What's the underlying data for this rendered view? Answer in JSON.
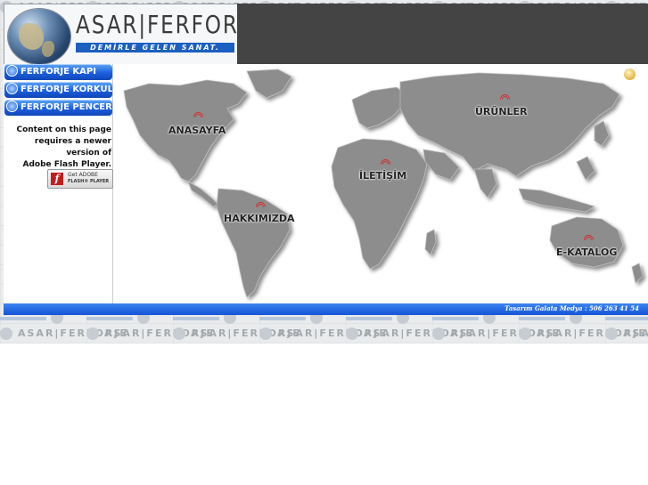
{
  "header": {
    "logo_text": "ASAR|FERFORJE",
    "slogan": "DEMİRLE GELEN SANAT."
  },
  "watermark_text": "ASAR|FERFORJE",
  "nav": {
    "items": [
      {
        "label": "FERFORJE KAPI"
      },
      {
        "label": "FERFORJE KORKULUK"
      },
      {
        "label": "FERFORJE PENCERE"
      }
    ]
  },
  "flash_notice": {
    "line1": "Content on this page",
    "line2": "requires a newer version of",
    "line3": "Adobe Flash Player.",
    "badge_line1": "Get ADOBE",
    "badge_line2": "FLASH® PLAYER",
    "badge_glyph": "f"
  },
  "map": {
    "labels": {
      "home": "ANASAYFA",
      "products": "ÜRÜNLER",
      "contact": "İLETİŞİM",
      "about": "HAKKIMIZDA",
      "catalog": "E-KATALOG"
    }
  },
  "footer": {
    "credit": "Tasarım Galata Medya : 506 263 41 54"
  },
  "colors": {
    "accent_blue": "#1b5fe0",
    "dark_bar": "#444444",
    "map_land": "#8a8a8a",
    "signal_red": "#d23030"
  }
}
